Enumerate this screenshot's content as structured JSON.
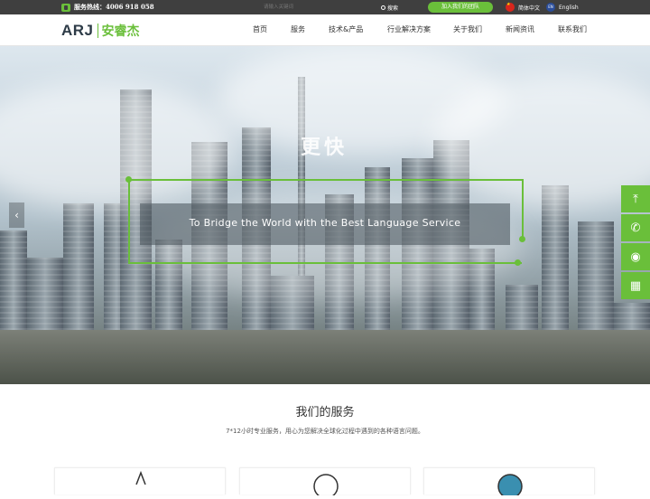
{
  "topbar": {
    "hotline": "服务热线：4006 918 058",
    "search_placeholder": "请输入关键词",
    "search_button": "搜索",
    "join_button": "加入我们的团队",
    "lang_cn": "简体中文",
    "lang_en": "English",
    "flag_en_text": "EN"
  },
  "logo": {
    "latin": "ARJ",
    "chinese": "安睿杰"
  },
  "nav": {
    "items": [
      "首页",
      "服务",
      "技术&产品",
      "行业解决方案",
      "关于我们",
      "新闻资讯",
      "联系我们"
    ]
  },
  "hero": {
    "title": "更快",
    "subtitle": "To Bridge the World with the Best Language Service",
    "prev_arrow": "‹"
  },
  "side_tools": {
    "icons": [
      "top-arrow-icon",
      "phone-icon",
      "qq-icon",
      "qr-code-icon"
    ],
    "glyphs": [
      "⤒",
      "✆",
      "◉",
      "▦"
    ]
  },
  "services": {
    "title": "我们的服务",
    "description": "7*12小时专业服务，用心为您解决全球化过程中遇到的各种语言问题。"
  },
  "colors": {
    "accent": "#6abf3a",
    "topbar_bg": "#3f3f3f",
    "logo_dark": "#2d3b47"
  }
}
